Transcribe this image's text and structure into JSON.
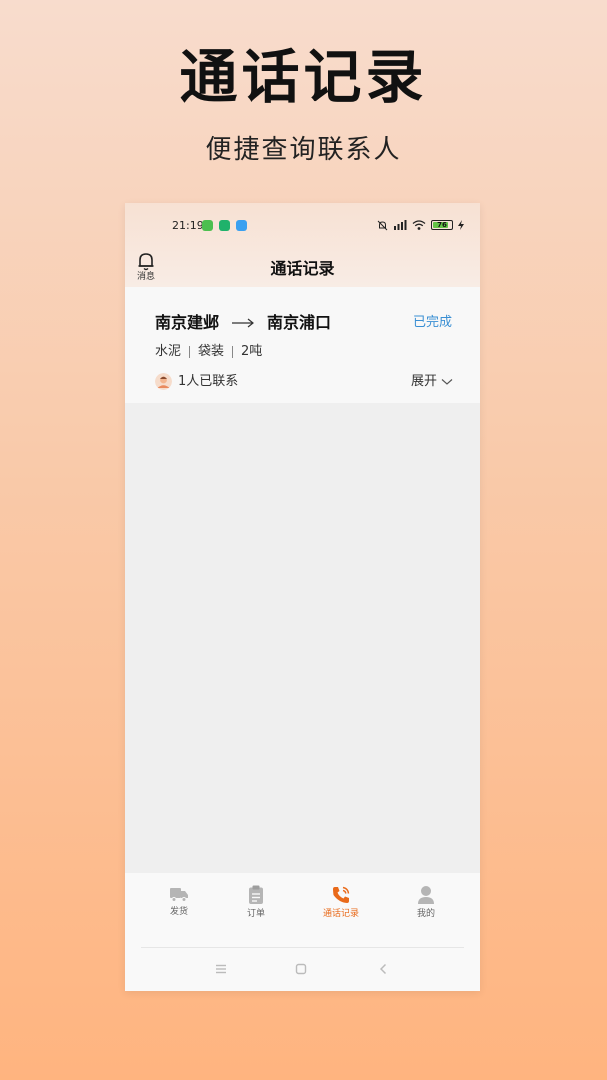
{
  "promo": {
    "title": "通话记录",
    "subtitle": "便捷查询联系人"
  },
  "status_bar": {
    "time": "21:19",
    "battery": "76",
    "app_icon_colors": [
      "#4cbf4f",
      "#1fb26b",
      "#3aa0f0"
    ]
  },
  "header": {
    "bell_label": "消息",
    "title": "通话记录"
  },
  "record": {
    "origin": "南京建邺",
    "destination": "南京浦口",
    "status": "已完成",
    "specs": [
      "水泥",
      "袋装",
      "2吨"
    ],
    "contacts": "1人已联系",
    "expand_label": "展开"
  },
  "tabs": [
    {
      "label": "发货",
      "icon": "truck-icon",
      "active": false
    },
    {
      "label": "订单",
      "icon": "clipboard-icon",
      "active": false
    },
    {
      "label": "通话记录",
      "icon": "phone-icon",
      "active": true
    },
    {
      "label": "我的",
      "icon": "user-icon",
      "active": false
    }
  ],
  "colors": {
    "accent": "#e96a1a",
    "status_done": "#3a8fd3"
  }
}
